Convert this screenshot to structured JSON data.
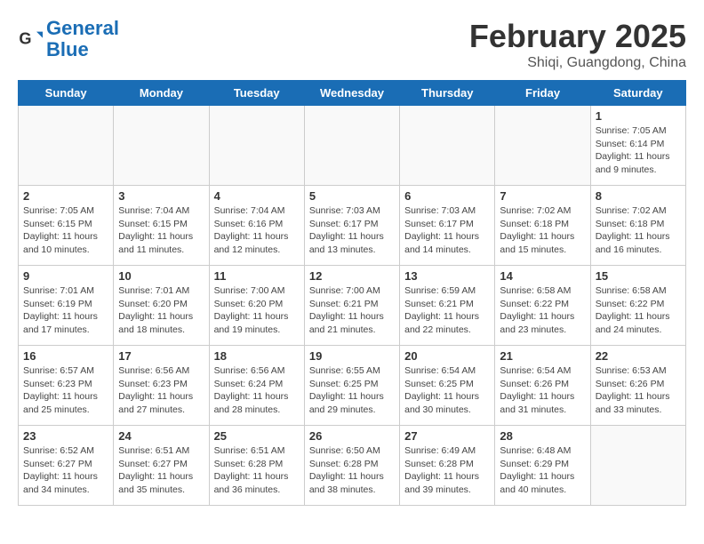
{
  "header": {
    "logo_general": "General",
    "logo_blue": "Blue",
    "title": "February 2025",
    "subtitle": "Shiqi, Guangdong, China"
  },
  "weekdays": [
    "Sunday",
    "Monday",
    "Tuesday",
    "Wednesday",
    "Thursday",
    "Friday",
    "Saturday"
  ],
  "weeks": [
    [
      {
        "day": "",
        "info": ""
      },
      {
        "day": "",
        "info": ""
      },
      {
        "day": "",
        "info": ""
      },
      {
        "day": "",
        "info": ""
      },
      {
        "day": "",
        "info": ""
      },
      {
        "day": "",
        "info": ""
      },
      {
        "day": "1",
        "info": "Sunrise: 7:05 AM\nSunset: 6:14 PM\nDaylight: 11 hours\nand 9 minutes."
      }
    ],
    [
      {
        "day": "2",
        "info": "Sunrise: 7:05 AM\nSunset: 6:15 PM\nDaylight: 11 hours\nand 10 minutes."
      },
      {
        "day": "3",
        "info": "Sunrise: 7:04 AM\nSunset: 6:15 PM\nDaylight: 11 hours\nand 11 minutes."
      },
      {
        "day": "4",
        "info": "Sunrise: 7:04 AM\nSunset: 6:16 PM\nDaylight: 11 hours\nand 12 minutes."
      },
      {
        "day": "5",
        "info": "Sunrise: 7:03 AM\nSunset: 6:17 PM\nDaylight: 11 hours\nand 13 minutes."
      },
      {
        "day": "6",
        "info": "Sunrise: 7:03 AM\nSunset: 6:17 PM\nDaylight: 11 hours\nand 14 minutes."
      },
      {
        "day": "7",
        "info": "Sunrise: 7:02 AM\nSunset: 6:18 PM\nDaylight: 11 hours\nand 15 minutes."
      },
      {
        "day": "8",
        "info": "Sunrise: 7:02 AM\nSunset: 6:18 PM\nDaylight: 11 hours\nand 16 minutes."
      }
    ],
    [
      {
        "day": "9",
        "info": "Sunrise: 7:01 AM\nSunset: 6:19 PM\nDaylight: 11 hours\nand 17 minutes."
      },
      {
        "day": "10",
        "info": "Sunrise: 7:01 AM\nSunset: 6:20 PM\nDaylight: 11 hours\nand 18 minutes."
      },
      {
        "day": "11",
        "info": "Sunrise: 7:00 AM\nSunset: 6:20 PM\nDaylight: 11 hours\nand 19 minutes."
      },
      {
        "day": "12",
        "info": "Sunrise: 7:00 AM\nSunset: 6:21 PM\nDaylight: 11 hours\nand 21 minutes."
      },
      {
        "day": "13",
        "info": "Sunrise: 6:59 AM\nSunset: 6:21 PM\nDaylight: 11 hours\nand 22 minutes."
      },
      {
        "day": "14",
        "info": "Sunrise: 6:58 AM\nSunset: 6:22 PM\nDaylight: 11 hours\nand 23 minutes."
      },
      {
        "day": "15",
        "info": "Sunrise: 6:58 AM\nSunset: 6:22 PM\nDaylight: 11 hours\nand 24 minutes."
      }
    ],
    [
      {
        "day": "16",
        "info": "Sunrise: 6:57 AM\nSunset: 6:23 PM\nDaylight: 11 hours\nand 25 minutes."
      },
      {
        "day": "17",
        "info": "Sunrise: 6:56 AM\nSunset: 6:23 PM\nDaylight: 11 hours\nand 27 minutes."
      },
      {
        "day": "18",
        "info": "Sunrise: 6:56 AM\nSunset: 6:24 PM\nDaylight: 11 hours\nand 28 minutes."
      },
      {
        "day": "19",
        "info": "Sunrise: 6:55 AM\nSunset: 6:25 PM\nDaylight: 11 hours\nand 29 minutes."
      },
      {
        "day": "20",
        "info": "Sunrise: 6:54 AM\nSunset: 6:25 PM\nDaylight: 11 hours\nand 30 minutes."
      },
      {
        "day": "21",
        "info": "Sunrise: 6:54 AM\nSunset: 6:26 PM\nDaylight: 11 hours\nand 31 minutes."
      },
      {
        "day": "22",
        "info": "Sunrise: 6:53 AM\nSunset: 6:26 PM\nDaylight: 11 hours\nand 33 minutes."
      }
    ],
    [
      {
        "day": "23",
        "info": "Sunrise: 6:52 AM\nSunset: 6:27 PM\nDaylight: 11 hours\nand 34 minutes."
      },
      {
        "day": "24",
        "info": "Sunrise: 6:51 AM\nSunset: 6:27 PM\nDaylight: 11 hours\nand 35 minutes."
      },
      {
        "day": "25",
        "info": "Sunrise: 6:51 AM\nSunset: 6:28 PM\nDaylight: 11 hours\nand 36 minutes."
      },
      {
        "day": "26",
        "info": "Sunrise: 6:50 AM\nSunset: 6:28 PM\nDaylight: 11 hours\nand 38 minutes."
      },
      {
        "day": "27",
        "info": "Sunrise: 6:49 AM\nSunset: 6:28 PM\nDaylight: 11 hours\nand 39 minutes."
      },
      {
        "day": "28",
        "info": "Sunrise: 6:48 AM\nSunset: 6:29 PM\nDaylight: 11 hours\nand 40 minutes."
      },
      {
        "day": "",
        "info": ""
      }
    ]
  ]
}
